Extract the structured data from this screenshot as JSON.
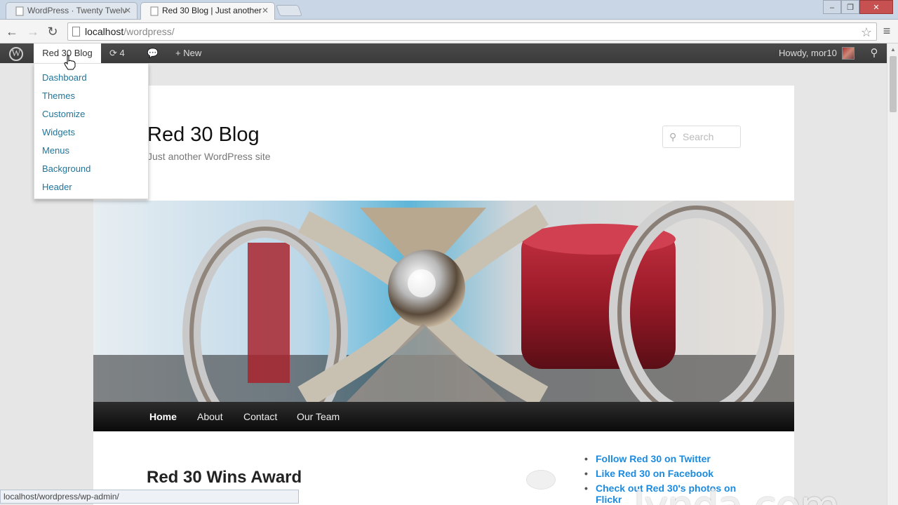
{
  "browser": {
    "tabs": [
      {
        "title": "WordPress · Twenty Twelv",
        "active": false
      },
      {
        "title": "Red 30 Blog | Just another",
        "active": true
      }
    ],
    "url": {
      "host": "localhost",
      "path": "/wordpress/"
    },
    "status_url": "localhost/wordpress/wp-admin/"
  },
  "adminbar": {
    "site_name": "Red 30 Blog",
    "updates_count": "4",
    "new_label": "New",
    "howdy": "Howdy, mor10"
  },
  "dropdown": {
    "items": [
      "Dashboard",
      "Themes",
      "Customize",
      "Widgets",
      "Menus",
      "Background",
      "Header"
    ]
  },
  "site": {
    "title": "Red 30 Blog",
    "description": "Just another WordPress site",
    "search_placeholder": "Search",
    "nav": [
      "Home",
      "About",
      "Contact",
      "Our Team"
    ],
    "post_title": "Red 30 Wins Award",
    "widget_links": [
      "Follow Red 30 on Twitter",
      "Like Red 30 on Facebook",
      "Check out Red 30's photos on Flickr"
    ]
  },
  "watermark": "lynda.com",
  "colors": {
    "adminbar": "#464646",
    "link": "#21759b",
    "nav": "#1a1a1a"
  }
}
